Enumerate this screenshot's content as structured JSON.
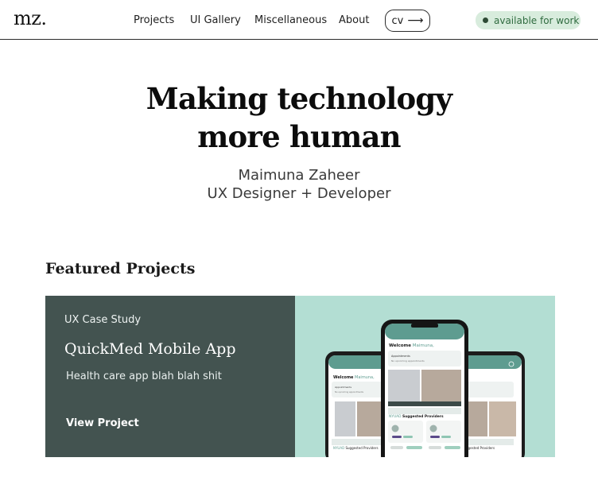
{
  "nav": {
    "logo": "mz.",
    "links": [
      "Projects",
      "UI Gallery",
      "Miscellaneous",
      "About"
    ],
    "cv_label": "cv",
    "status_label": "available for work"
  },
  "hero": {
    "title_line1": "Making technology",
    "title_line2": "more human",
    "name": "Maimuna Zaheer",
    "role": "UX Designer + Developer"
  },
  "featured": {
    "heading": "Featured Projects",
    "card": {
      "kicker": "UX Case Study",
      "title": "QuickMed Mobile App",
      "description": "Health care app blah blah shit",
      "cta": "View Project",
      "mockup": {
        "welcome_prefix": "Welcome",
        "user_name": "Maimuna,",
        "appointments_label": "Appointments",
        "no_appointments": "No upcoming appointments",
        "suggested_prefix": "NYUAD",
        "suggested_label": "Suggested Providers"
      }
    }
  },
  "colors": {
    "card_dark": "#435350",
    "card_mint": "#b3ded3",
    "status_bg": "#d8ecdd",
    "status_text": "#2f6b3f",
    "accent_teal": "#5e9c90"
  }
}
